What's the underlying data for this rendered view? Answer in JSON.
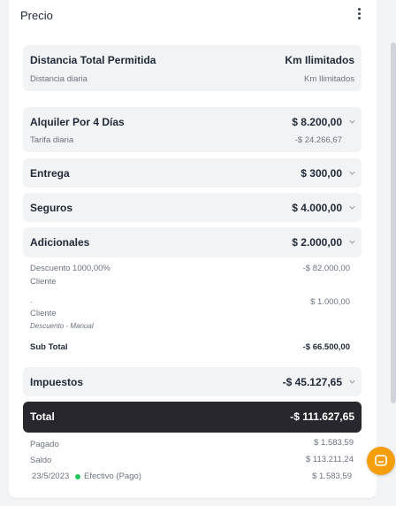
{
  "header": {
    "title": "Precio",
    "menu_icon": "kebab-menu-icon"
  },
  "distance": {
    "label": "Distancia Total Permitida",
    "value": "Km Ilimitados",
    "sub_label": "Distancia diaria",
    "sub_value": "Km Ilimitados"
  },
  "rental": {
    "label": "Alquiler Por 4 Días",
    "value": "$ 8.200,00",
    "sub_label": "Tarifa diaria",
    "sub_value": "-$ 24.266,67"
  },
  "delivery": {
    "label": "Entrega",
    "value": "$ 300,00"
  },
  "insurance": {
    "label": "Seguros",
    "value": "$ 4.000,00"
  },
  "extras": {
    "label": "Adicionales",
    "value": "$ 2.000,00"
  },
  "lines": {
    "discount_label": "Descuento 1000,00%",
    "discount_sub": "Cliente",
    "discount_value": "-$ 82.000,00",
    "item_dot": ".",
    "item_sub": "Cliente",
    "item_note": "Descuento - Manual",
    "item_value": "$ 1.000,00",
    "subtotal_label": "Sub Total",
    "subtotal_value": "-$ 66.500,00"
  },
  "taxes": {
    "label": "Impuestos",
    "value": "-$ 45.127,65"
  },
  "total": {
    "label": "Total",
    "value": "-$ 111.627,65"
  },
  "payments": {
    "paid_label": "Pagado",
    "paid_value": "$ 1.583,59",
    "balance_label": "Saldo",
    "balance_value": "$ 113.211,24",
    "entry_date": "23/5/2023",
    "entry_method": "Efectivo (Pago)",
    "entry_value": "$ 1.583,59",
    "status_color": "#22c55e"
  },
  "chat": {
    "icon": "chat-bubble-icon",
    "color": "#f59e0b"
  }
}
